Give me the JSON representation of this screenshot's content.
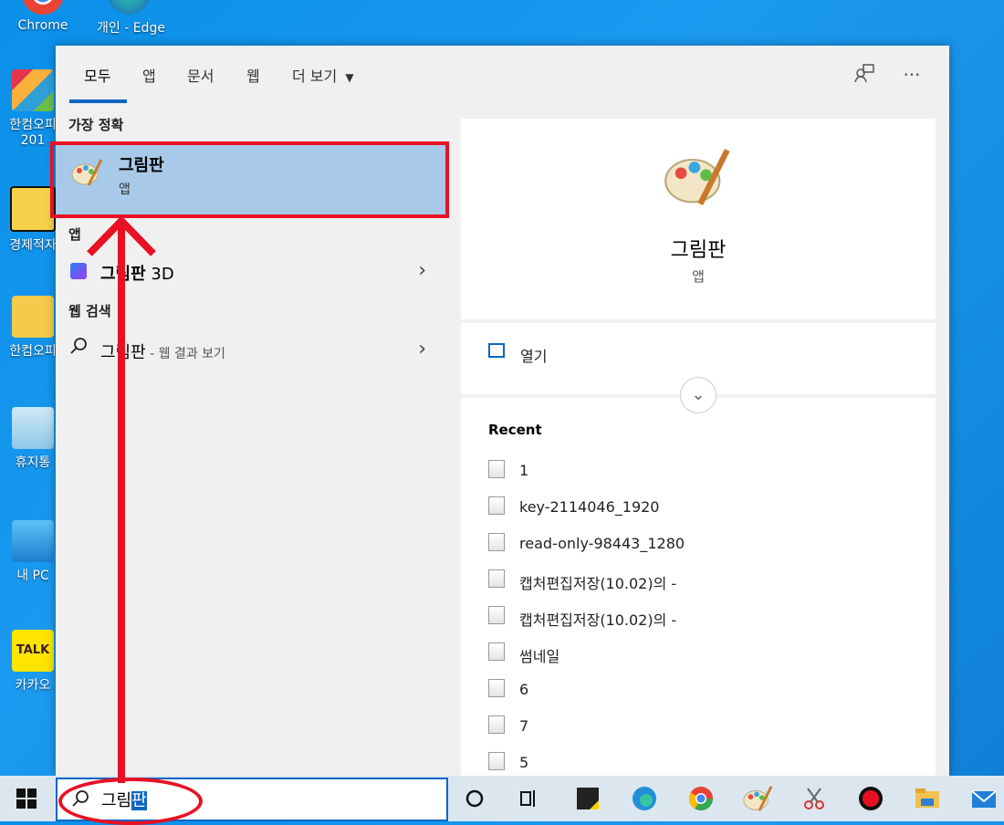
{
  "desktop": {
    "icons": [
      {
        "label": "Chrome"
      },
      {
        "label": "개인 - Edge"
      },
      {
        "label": "한컴오피\n201"
      },
      {
        "label": "경제적자"
      },
      {
        "label": "한컴오피"
      },
      {
        "label": "휴지통"
      },
      {
        "label": "내 PC"
      },
      {
        "label": "카카오"
      }
    ]
  },
  "search_panel": {
    "tabs": [
      {
        "label": "모두",
        "active": true
      },
      {
        "label": "앱"
      },
      {
        "label": "문서"
      },
      {
        "label": "웹"
      },
      {
        "label": "더 보기"
      }
    ],
    "toolbar": {
      "feedback_icon": "feedback-icon",
      "more_icon": "more-icon"
    },
    "best_match": {
      "heading": "가장 정확",
      "title": "그림판",
      "subtitle": "앱",
      "icon": "paint-palette-icon"
    },
    "apps": {
      "heading": "앱",
      "items": [
        {
          "label_bold": "그림판",
          "label_rest": " 3D",
          "icon": "paint3d-icon"
        }
      ]
    },
    "web": {
      "heading": "웹 검색",
      "items": [
        {
          "label": "그림판",
          "suffix": " - 웹 결과 보기",
          "icon": "search-icon"
        }
      ]
    },
    "preview": {
      "title": "그림판",
      "subtitle": "앱",
      "open_label": "열기",
      "recent_heading": "Recent",
      "recent_items": [
        {
          "label": "1"
        },
        {
          "label": "key-2114046_1920"
        },
        {
          "label": "read-only-98443_1280"
        },
        {
          "label": "캡처편집저장(10.02)의 -"
        },
        {
          "label": "캡처편집저장(10.02)의 -"
        },
        {
          "label": "썸네일"
        },
        {
          "label": "6"
        },
        {
          "label": "7"
        },
        {
          "label": "5"
        }
      ]
    }
  },
  "taskbar": {
    "search_typed": "그림",
    "search_selected": "판",
    "apps": [
      "start-icon",
      "cortana-icon",
      "taskview-icon",
      "sticky-notes-icon",
      "edge-icon",
      "chrome-icon",
      "paint-icon",
      "snip-icon",
      "recorder-icon",
      "file-explorer-icon",
      "mail-icon"
    ]
  },
  "colors": {
    "accent": "#0a66c2",
    "highlight": "#a8c9e8",
    "annotation": "#e81123",
    "desktop": "#0f7fd6"
  }
}
